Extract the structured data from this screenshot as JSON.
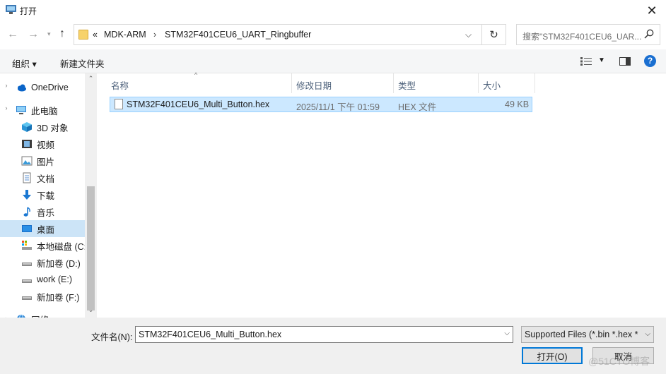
{
  "window": {
    "title": "打开"
  },
  "address": {
    "overflow": "«",
    "crumbs": [
      "MDK-ARM",
      "STM32F401CEU6_UART_Ringbuffer"
    ]
  },
  "search": {
    "placeholder": "搜索\"STM32F401CEU6_UAR..."
  },
  "toolbar": {
    "organize": "组织 ▾",
    "new_folder": "新建文件夹"
  },
  "sidebar": {
    "items": [
      {
        "label": "OneDrive",
        "icon": "cloud-icon"
      },
      {
        "label": "此电脑",
        "icon": "computer-icon"
      },
      {
        "label": "3D 对象",
        "icon": "cube-icon"
      },
      {
        "label": "视频",
        "icon": "video-icon"
      },
      {
        "label": "图片",
        "icon": "picture-icon"
      },
      {
        "label": "文档",
        "icon": "document-icon"
      },
      {
        "label": "下载",
        "icon": "download-icon"
      },
      {
        "label": "音乐",
        "icon": "music-icon"
      },
      {
        "label": "桌面",
        "icon": "desktop-icon"
      },
      {
        "label": "本地磁盘 (C:)",
        "icon": "drive-icon"
      },
      {
        "label": "新加卷 (D:)",
        "icon": "drive-icon"
      },
      {
        "label": "work (E:)",
        "icon": "drive-icon"
      },
      {
        "label": "新加卷 (F:)",
        "icon": "drive-icon"
      },
      {
        "label": "网络",
        "icon": "network-icon"
      }
    ]
  },
  "columns": {
    "name": "名称",
    "date": "修改日期",
    "type": "类型",
    "size": "大小"
  },
  "files": [
    {
      "name": "STM32F401CEU6_Multi_Button.hex",
      "date": "2025/11/1 下午 01:59",
      "type": "HEX 文件",
      "size": "49 KB"
    }
  ],
  "footer": {
    "filename_label": "文件名(N):",
    "filename_value": "STM32F401CEU6_Multi_Button.hex",
    "filter_value": "Supported Files (*.bin *.hex *",
    "open_label": "打开(O)",
    "cancel_label": "取消"
  },
  "watermark": "@51CTO博客",
  "colors": {
    "selection": "#cce8ff",
    "accent": "#0078d7",
    "sidebar_selected": "#cce4f7"
  }
}
